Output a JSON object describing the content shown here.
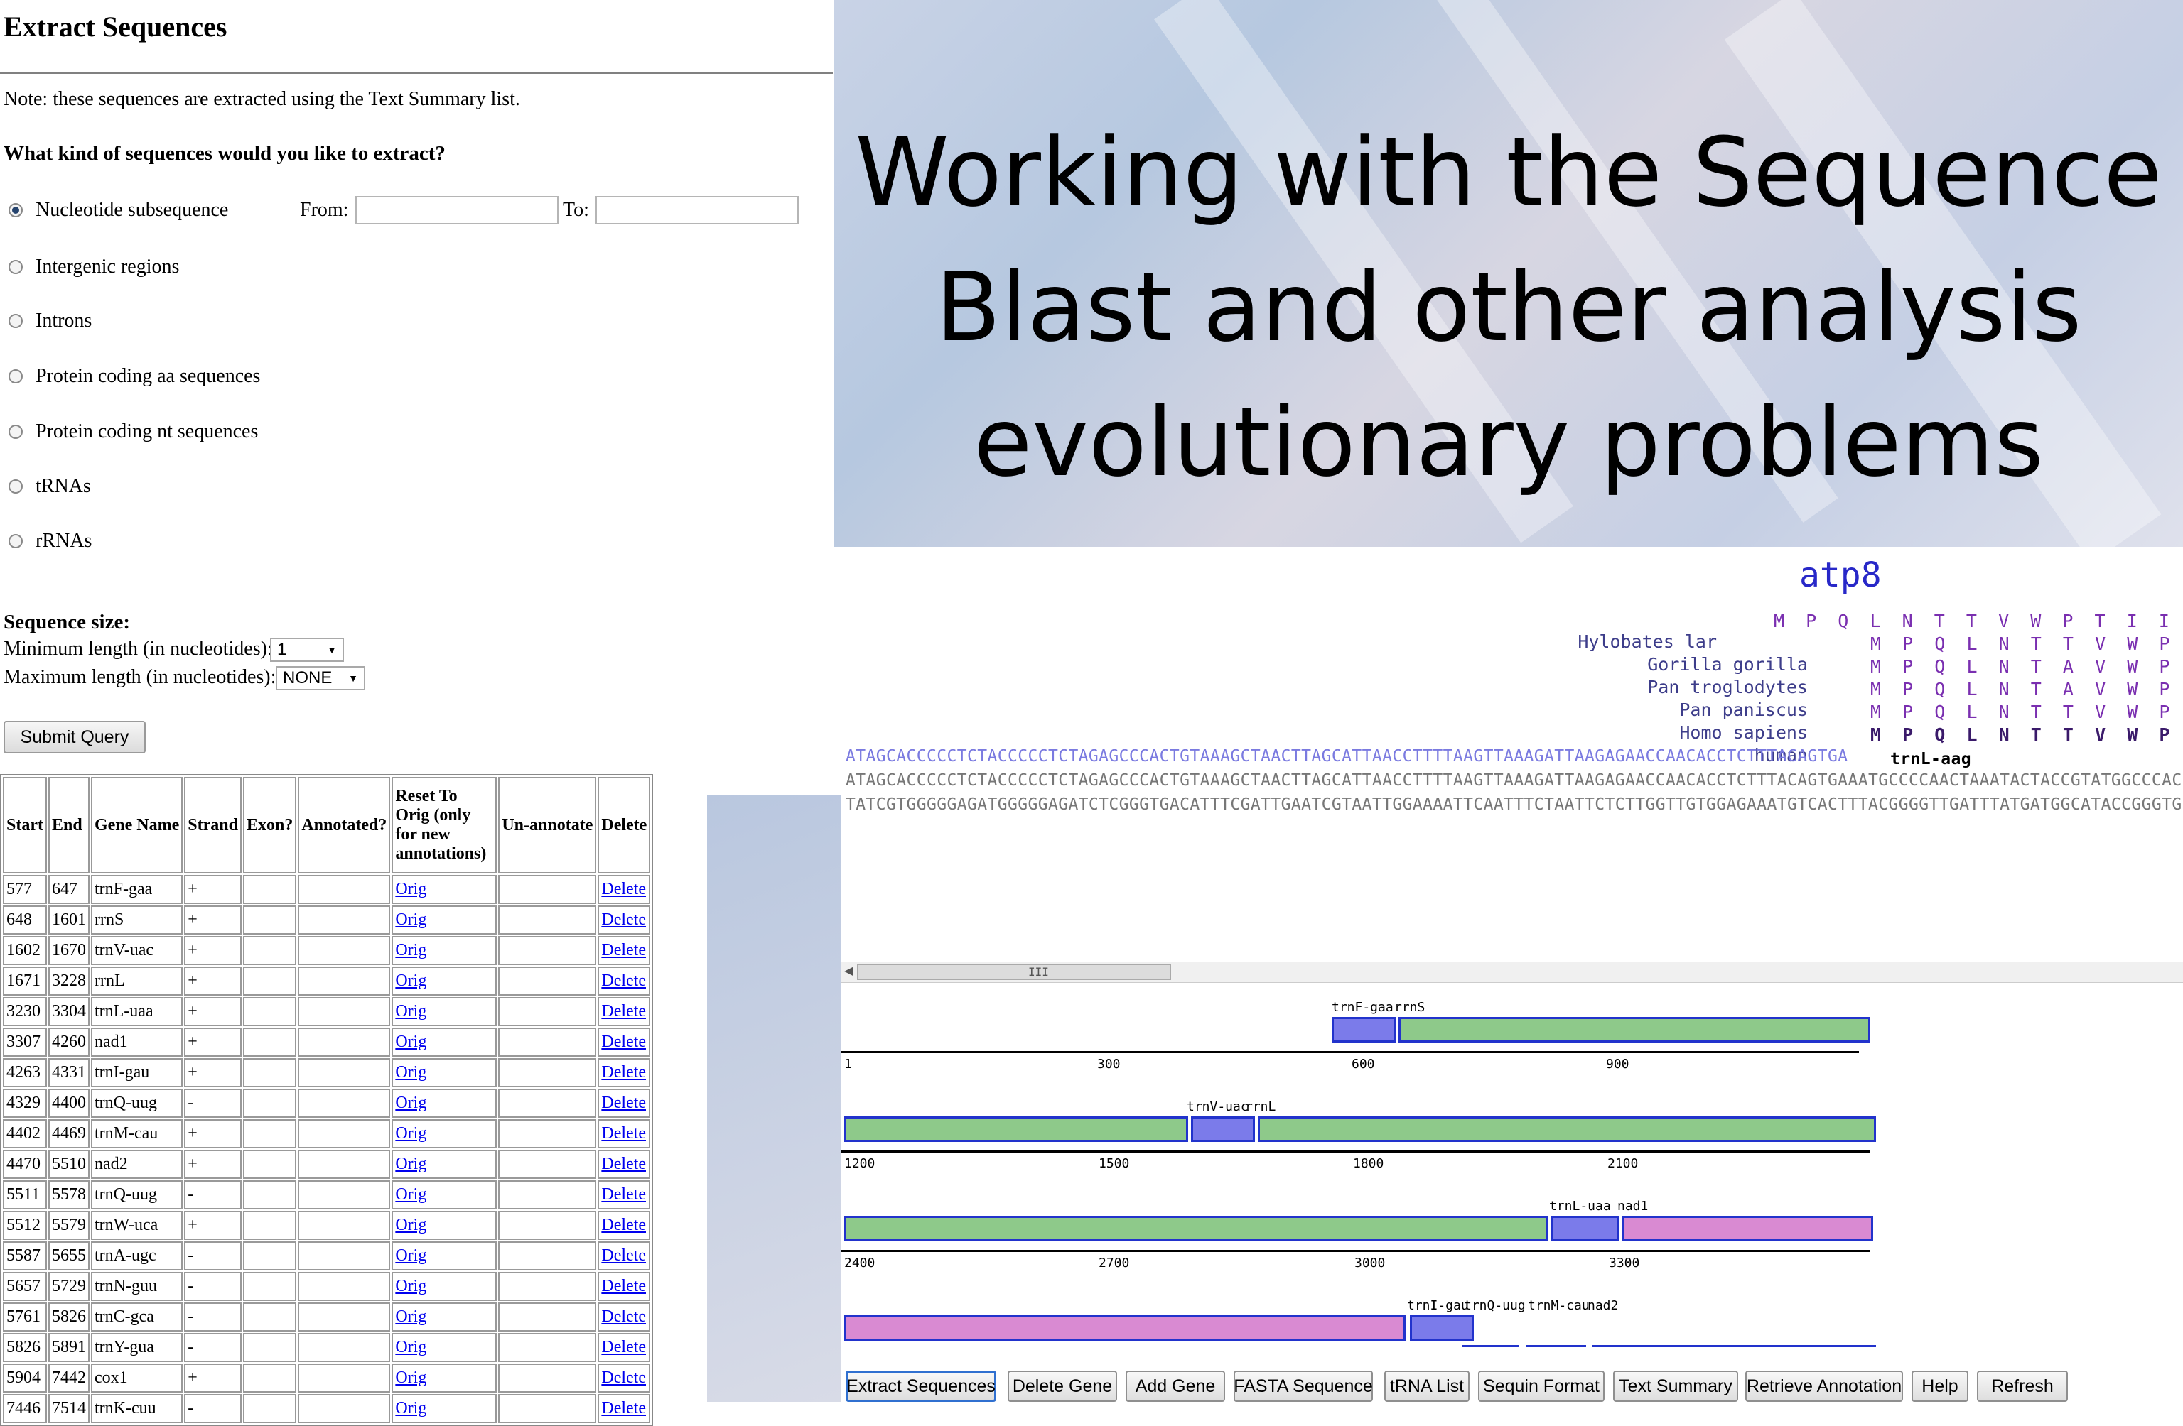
{
  "form": {
    "title": "Extract Sequences",
    "note": "Note: these sequences are extracted using the Text Summary list.",
    "question": "What kind of sequences would you like to extract?",
    "options": [
      {
        "label": "Nucleotide subsequence",
        "checked": true
      },
      {
        "label": "Intergenic regions",
        "checked": false
      },
      {
        "label": "Introns",
        "checked": false
      },
      {
        "label": "Protein coding aa sequences",
        "checked": false
      },
      {
        "label": "Protein coding nt sequences",
        "checked": false
      },
      {
        "label": "tRNAs",
        "checked": false
      },
      {
        "label": "rRNAs",
        "checked": false
      }
    ],
    "from_label": "From:",
    "to_label": "To:",
    "from_value": "",
    "to_value": "",
    "size_heading": "Sequence size:",
    "min_label": "Minimum length (in nucleotides):",
    "min_value": "1",
    "max_label": "Maximum length (in nucleotides):",
    "max_value": "NONE",
    "submit_label": "Submit Query"
  },
  "table": {
    "headers": [
      "Start",
      "End",
      "Gene Name",
      "Strand",
      "Exon?",
      "Annotated?",
      "Reset To Orig (only for new annotations)",
      "Un-annotate",
      "Delete"
    ],
    "orig_label": "Orig",
    "delete_label": "Delete",
    "rows": [
      [
        "577",
        "647",
        "trnF-gaa",
        "+"
      ],
      [
        "648",
        "1601",
        "rrnS",
        "+"
      ],
      [
        "1602",
        "1670",
        "trnV-uac",
        "+"
      ],
      [
        "1671",
        "3228",
        "rrnL",
        "+"
      ],
      [
        "3230",
        "3304",
        "trnL-uaa",
        "+"
      ],
      [
        "3307",
        "4260",
        "nad1",
        "+"
      ],
      [
        "4263",
        "4331",
        "trnI-gau",
        "+"
      ],
      [
        "4329",
        "4400",
        "trnQ-uug",
        "-"
      ],
      [
        "4402",
        "4469",
        "trnM-cau",
        "+"
      ],
      [
        "4470",
        "5510",
        "nad2",
        "+"
      ],
      [
        "5511",
        "5578",
        "trnQ-uug",
        "-"
      ],
      [
        "5512",
        "5579",
        "trnW-uca",
        "+"
      ],
      [
        "5587",
        "5655",
        "trnA-ugc",
        "-"
      ],
      [
        "5657",
        "5729",
        "trnN-guu",
        "-"
      ],
      [
        "5761",
        "5826",
        "trnC-gca",
        "-"
      ],
      [
        "5826",
        "5891",
        "trnY-gua",
        "-"
      ],
      [
        "5904",
        "7442",
        "cox1",
        "+"
      ],
      [
        "7446",
        "7514",
        "trnK-cuu",
        "-"
      ]
    ]
  },
  "slide": {
    "title_lines": [
      "Working with the Sequence",
      "Blast and other analysis",
      "evolutionary problems"
    ]
  },
  "viewer": {
    "gene_title": "atp8",
    "species": [
      "Hylobates lar",
      "Gorilla gorilla",
      "Pan troglodytes",
      "Pan paniscus",
      "Homo sapiens",
      "human"
    ],
    "aa_rows": [
      "M  P  Q  L  N  T  T  V  W  P  T  I  I  M",
      "M  P  Q  L  N  T  T  V  W  P  T",
      "M  P  Q  L  N  T  A  V  W  P  T",
      "M  P  Q  L  N  T  A  V  W  P  T",
      "M  P  Q  L  N  T  T  V  W  P  T",
      "M  P  Q  L  N  T  T  V  W  P  T"
    ],
    "seq_line_1": "ATAGCACCCCCTCTACCCCCTCTAGAGCCCACTGTAAAGCTAACTTAGCATTAACCTTTTAAGTTAAAGATTAAGAGAACCAACACCTCTTTACAGTGA",
    "seq_line_1_label": "trnL-aag",
    "seq_line_2": "ATAGCACCCCCTCTACCCCCTCTAGAGCCCACTGTAAAGCTAACTTAGCATTAACCTTTTAAGTTAAAGATTAAGAGAACCAACACCTCTTTACAGTGAAATGCCCCAACTAAATACTACCGTATGGCCCAC",
    "seq_line_3": "TATCGTGGGGGAGATGGGGGAGATCTCGGGTGACATTTCGATTGAATCGTAATTGGAAAATTCAATTTCTAATTCTCTTGGTTGTGGAGAAATGTCACTTTACGGGGTTGATTTATGATGGCATACCGGGTG",
    "scroll_grip": "III",
    "tracks": [
      {
        "ticks": [
          "1",
          "300",
          "600",
          "900"
        ],
        "labels": [
          "trnF-gaa",
          "rrnS"
        ]
      },
      {
        "ticks": [
          "1200",
          "1500",
          "1800",
          "2100"
        ],
        "labels": [
          "trnV-uac",
          "rrnL"
        ]
      },
      {
        "ticks": [
          "2400",
          "2700",
          "3000",
          "3300"
        ],
        "labels": [
          "trnL-uaa",
          "nad1"
        ]
      },
      {
        "ticks": [],
        "labels": [
          "trnI-gau",
          "trnQ-uug",
          "trnM-cau",
          "nad2"
        ]
      }
    ],
    "colors": {
      "rrna": "#8ec98a",
      "trna": "#7b7bea",
      "protein": "#d98ad2",
      "outline": "#2233cc"
    }
  },
  "toolbar": {
    "buttons": [
      "Extract Sequences",
      "Delete Gene",
      "Add Gene",
      "FASTA Sequence",
      "tRNA List",
      "Sequin Format",
      "Text Summary",
      "Retrieve Annotation",
      "Help",
      "Refresh"
    ]
  }
}
